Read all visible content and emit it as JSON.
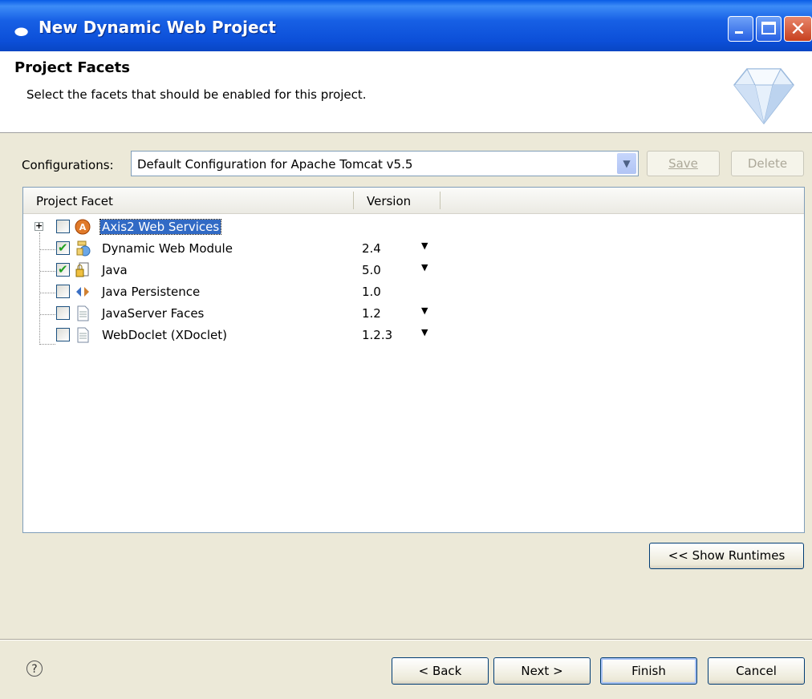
{
  "window": {
    "title": "New Dynamic Web Project",
    "title_icon": "eclipse-icon"
  },
  "header": {
    "title": "Project Facets",
    "description": "Select the facets that should be enabled for this project."
  },
  "configurations": {
    "label": "Configurations:",
    "value": "Default Configuration for Apache Tomcat v5.5",
    "save_label": "Save",
    "delete_label": "Delete"
  },
  "table": {
    "columns": [
      "Project Facet",
      "Version"
    ],
    "rows": [
      {
        "name": "Axis2 Web Services",
        "version": "",
        "checked": false,
        "expandable": true,
        "selected": true,
        "icon": "axis2-icon"
      },
      {
        "name": "Dynamic Web Module",
        "version": "2.4",
        "checked": true,
        "dropdown": true,
        "icon": "web-module-icon"
      },
      {
        "name": "Java",
        "version": "5.0",
        "checked": true,
        "dropdown": true,
        "icon": "java-lock-icon"
      },
      {
        "name": "Java Persistence",
        "version": "1.0",
        "checked": false,
        "dropdown": false,
        "icon": "persistence-icon"
      },
      {
        "name": "JavaServer Faces",
        "version": "1.2",
        "checked": false,
        "dropdown": true,
        "icon": "document-icon"
      },
      {
        "name": "WebDoclet (XDoclet)",
        "version": "1.2.3",
        "checked": false,
        "dropdown": true,
        "icon": "document-icon"
      }
    ]
  },
  "show_runtimes_label": "<< Show Runtimes",
  "footer": {
    "back_label": "< Back",
    "next_label": "Next >",
    "finish_label": "Finish",
    "cancel_label": "Cancel"
  }
}
